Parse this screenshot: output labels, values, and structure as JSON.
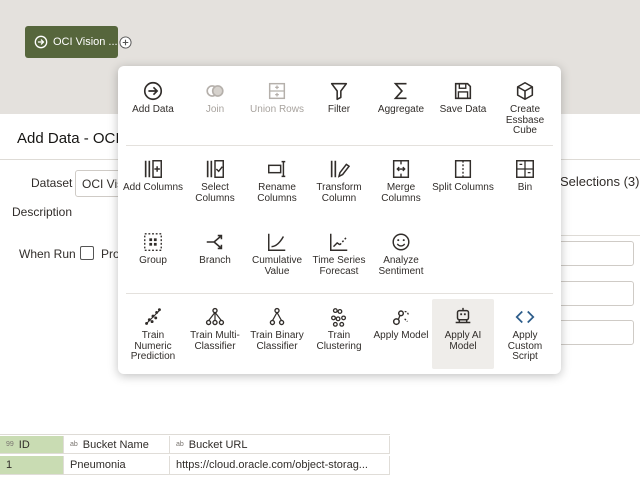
{
  "canvas": {
    "node_label": "OCI Vision ...",
    "node_color": "#56663c"
  },
  "panel": {
    "title": "Add Data - OCI",
    "dataset_label": "Dataset",
    "dataset_value": "OCI Visio",
    "description_label": "Description",
    "when_run_label": "When Run",
    "when_run_option": "Pro",
    "selections_text": "Selections (3)"
  },
  "menu": {
    "row1": [
      {
        "label": "Add Data",
        "icon": "arrow-right-circle-icon"
      },
      {
        "label": "Join",
        "icon": "join-icon",
        "disabled": true
      },
      {
        "label": "Union Rows",
        "icon": "union-rows-icon",
        "disabled": true
      },
      {
        "label": "Filter",
        "icon": "filter-icon"
      },
      {
        "label": "Aggregate",
        "icon": "sigma-icon"
      },
      {
        "label": "Save Data",
        "icon": "save-icon"
      },
      {
        "label": "Create Essbase Cube",
        "icon": "cube-icon"
      }
    ],
    "row2": [
      {
        "label": "Add Columns",
        "icon": "add-columns-icon"
      },
      {
        "label": "Select Columns",
        "icon": "select-columns-icon"
      },
      {
        "label": "Rename Columns",
        "icon": "rename-columns-icon"
      },
      {
        "label": "Transform Column",
        "icon": "transform-column-icon"
      },
      {
        "label": "Merge Columns",
        "icon": "merge-columns-icon"
      },
      {
        "label": "Split Columns",
        "icon": "split-columns-icon"
      },
      {
        "label": "Bin",
        "icon": "bin-icon"
      }
    ],
    "row3": [
      {
        "label": "Group",
        "icon": "group-icon"
      },
      {
        "label": "Branch",
        "icon": "branch-icon"
      },
      {
        "label": "Cumulative Value",
        "icon": "cumulative-icon"
      },
      {
        "label": "Time Series Forecast",
        "icon": "forecast-icon"
      },
      {
        "label": "Analyze Sentiment",
        "icon": "smiley-icon"
      }
    ],
    "row4": [
      {
        "label": "Train Numeric Prediction",
        "icon": "numeric-prediction-icon"
      },
      {
        "label": "Train Multi-Classifier",
        "icon": "multi-classifier-icon"
      },
      {
        "label": "Train Binary Classifier",
        "icon": "binary-classifier-icon"
      },
      {
        "label": "Train Clustering",
        "icon": "clustering-icon"
      },
      {
        "label": "Apply Model",
        "icon": "apply-model-icon"
      },
      {
        "label": "Apply AI Model",
        "icon": "robot-icon",
        "highlighted": true
      },
      {
        "label": "Apply Custom Script",
        "icon": "code-icon"
      }
    ]
  },
  "grid": {
    "columns": [
      {
        "type": "99",
        "name": "ID"
      },
      {
        "type": "ab",
        "name": "Bucket Name"
      },
      {
        "type": "ab",
        "name": "Bucket URL"
      }
    ],
    "rows": [
      [
        "1",
        "Pneumonia",
        "https://cloud.oracle.com/object-storag..."
      ]
    ]
  }
}
